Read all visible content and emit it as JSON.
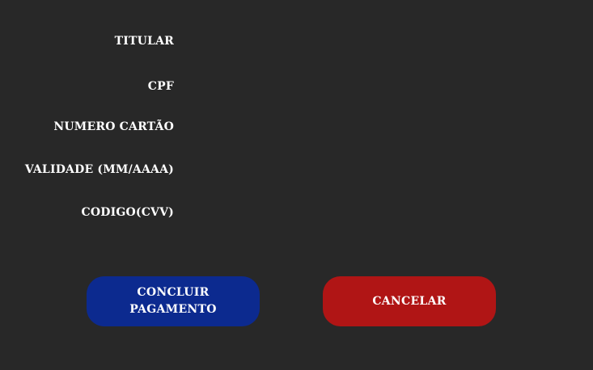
{
  "form": {
    "fields": [
      {
        "label": "TITULAR",
        "value": ""
      },
      {
        "label": "CPF",
        "value": ""
      },
      {
        "label": "NUMERO CARTÃO",
        "value": ""
      },
      {
        "label": "VALIDADE (MM/AAAA)",
        "value": ""
      },
      {
        "label": "CODIGO(CVV)",
        "value": ""
      }
    ]
  },
  "buttons": {
    "confirm_label": "CONCLUIR PAGAMENTO",
    "cancel_label": "CANCELAR"
  },
  "colors": {
    "background": "#282828",
    "confirm_button": "#0c2a8f",
    "cancel_button": "#b01515",
    "text": "#ffffff"
  }
}
